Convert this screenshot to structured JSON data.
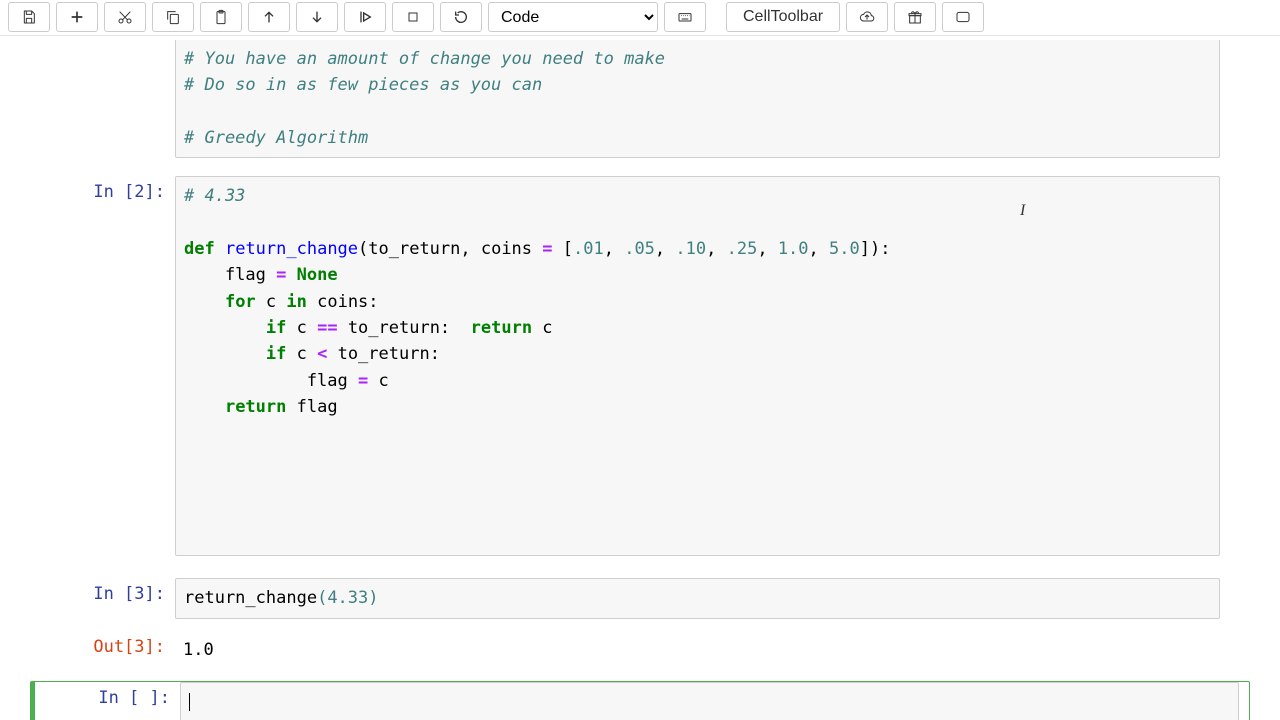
{
  "toolbar": {
    "celltype": "Code",
    "celltoolbar": "CellToolbar"
  },
  "cells": {
    "c1": {
      "prompt": "",
      "lines": {
        "l1": "# You have an amount of change you need to make",
        "l2": "# Do so in as few pieces as you can",
        "l3": "",
        "l4": "# Greedy Algorithm"
      }
    },
    "c2": {
      "prompt": "In [2]:",
      "code": {
        "comment": "# 4.33",
        "def": "def",
        "fname": "return_change",
        "sig_open": "(to_return, coins ",
        "eq": "=",
        "sig_list": " [",
        "n1": ".01",
        "c1": ", ",
        "n2": ".05",
        "c2": ", ",
        "n3": ".10",
        "c3": ", ",
        "n4": ".25",
        "c4": ", ",
        "n5": "1.0",
        "c5": ", ",
        "n6": "5.0",
        "sig_close": "]):",
        "l2a": "    flag ",
        "l2eq": "=",
        "l2sp": " ",
        "none": "None",
        "for": "for",
        "l3a": " c ",
        "in": "in",
        "l3b": " coins:",
        "if1": "if",
        "l4a": " c ",
        "eq2": "==",
        "l4b": " to_return:  ",
        "ret1": "return",
        "l4c": " c",
        "if2": "if",
        "l5a": " c ",
        "lt": "<",
        "l5b": " to_return:",
        "l6": "            flag ",
        "l6eq": "=",
        "l6b": " c",
        "ret2": "return",
        "l7": " flag"
      }
    },
    "c3": {
      "prompt": "In [3]:",
      "fn": "return_change",
      "paren_open": "(",
      "arg": "4.33",
      "paren_close": ")"
    },
    "out3": {
      "prompt": "Out[3]:",
      "value": "1.0"
    },
    "c4": {
      "prompt": "In [ ]:"
    }
  },
  "cursor": "I"
}
